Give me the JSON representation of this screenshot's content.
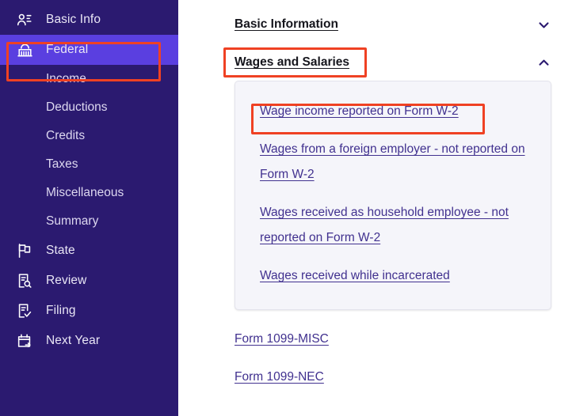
{
  "sidebar": {
    "items": [
      {
        "label": "Basic Info",
        "icon": "person-list-icon",
        "type": "nav",
        "active": false
      },
      {
        "label": "Federal",
        "icon": "capitol-building-icon",
        "type": "nav",
        "active": true
      },
      {
        "label": "Income",
        "icon": "",
        "type": "sub",
        "active": false
      },
      {
        "label": "Deductions",
        "icon": "",
        "type": "sub",
        "active": false
      },
      {
        "label": "Credits",
        "icon": "",
        "type": "sub",
        "active": false
      },
      {
        "label": "Taxes",
        "icon": "",
        "type": "sub",
        "active": false
      },
      {
        "label": "Miscellaneous",
        "icon": "",
        "type": "sub",
        "active": false
      },
      {
        "label": "Summary",
        "icon": "",
        "type": "sub",
        "active": false
      },
      {
        "label": "State",
        "icon": "flag-icon",
        "type": "nav",
        "active": false
      },
      {
        "label": "Review",
        "icon": "document-search-icon",
        "type": "nav",
        "active": false
      },
      {
        "label": "Filing",
        "icon": "document-check-icon",
        "type": "nav",
        "active": false
      },
      {
        "label": "Next Year",
        "icon": "calendar-arrow-icon",
        "type": "nav",
        "active": false
      }
    ],
    "colors": {
      "background": "#2b1a70",
      "active_background": "#5a3fe0",
      "text": "#e9e6f5"
    }
  },
  "main": {
    "sections": [
      {
        "title": "Basic Information",
        "chevron": "chevron-down-icon",
        "expanded": false
      },
      {
        "title": "Wages and Salaries",
        "chevron": "chevron-up-icon",
        "expanded": true
      }
    ],
    "wages_links": [
      "Wage income reported on Form W-2",
      "Wages from a foreign employer - not reported on Form W-2",
      "Wages received as household employee - not reported on Form W-2",
      "Wages received while incarcerated"
    ],
    "form_links": [
      "Form 1099-MISC",
      "Form 1099-NEC"
    ],
    "colors": {
      "link": "#41318f",
      "heading": "#15151c",
      "card_background": "#f5f5fa",
      "chevron": "#2b1a70"
    }
  },
  "annotations": {
    "highlight_color": "#ef4123",
    "boxes": [
      {
        "name": "federal-sidebar-item"
      },
      {
        "name": "wages-and-salaries-header"
      },
      {
        "name": "wage-income-w2-link"
      }
    ]
  }
}
